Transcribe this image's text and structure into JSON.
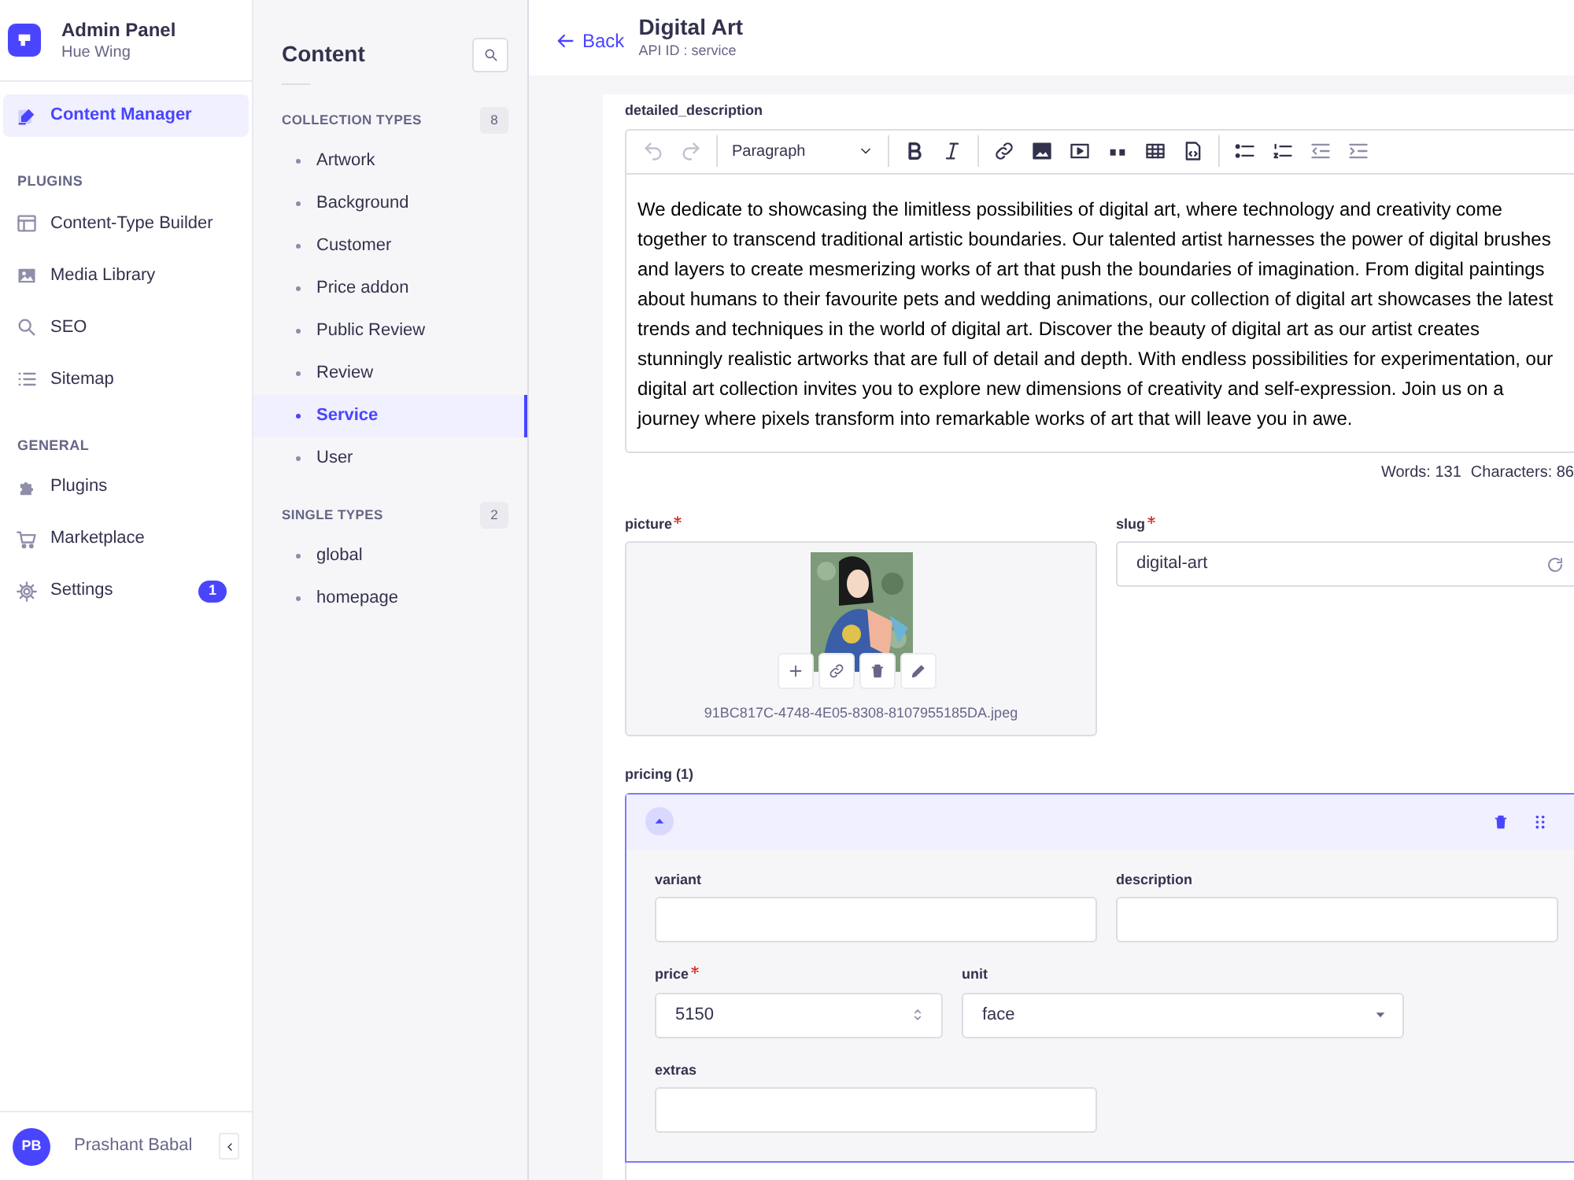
{
  "app": {
    "title": "Admin Panel",
    "subtitle": "Hue Wing"
  },
  "nav": [
    {
      "items": [
        {
          "label": "Content Manager",
          "selected": true
        }
      ]
    },
    {
      "heading": "PLUGINS",
      "items": [
        {
          "label": "Content-Type Builder",
          "selected": false
        },
        {
          "label": "Media Library",
          "selected": false
        },
        {
          "label": "SEO",
          "selected": false
        },
        {
          "label": "Sitemap",
          "selected": false
        }
      ]
    },
    {
      "heading": "GENERAL",
      "items": [
        {
          "label": "Plugins",
          "selected": false
        },
        {
          "label": "Marketplace",
          "selected": false
        },
        {
          "label": "Settings",
          "selected": false,
          "badge": "1"
        }
      ]
    }
  ],
  "user": {
    "initials": "PB",
    "name": "Prashant Babal"
  },
  "content_sidebar": {
    "title": "Content",
    "groups": [
      {
        "heading": "COLLECTION TYPES",
        "count": "8",
        "items": [
          {
            "label": "Artwork",
            "selected": false
          },
          {
            "label": "Background",
            "selected": false
          },
          {
            "label": "Customer",
            "selected": false
          },
          {
            "label": "Price addon",
            "selected": false
          },
          {
            "label": "Public Review",
            "selected": false
          },
          {
            "label": "Review",
            "selected": false
          },
          {
            "label": "Service",
            "selected": true
          },
          {
            "label": "User",
            "selected": false
          }
        ]
      },
      {
        "heading": "SINGLE TYPES",
        "count": "2",
        "items": [
          {
            "label": "global",
            "selected": false
          },
          {
            "label": "homepage",
            "selected": false
          }
        ]
      }
    ]
  },
  "header": {
    "back": "Back",
    "title": "Digital Art",
    "api_id": "API ID : service"
  },
  "editor": {
    "label": "detailed_description",
    "format": "Paragraph",
    "text": "We dedicate to showcasing the limitless possibilities of digital art, where technology and creativity come together to transcend traditional artistic boundaries. Our talented artist harnesses the power of digital brushes and layers to create mesmerizing works of art that push the boundaries of imagination. From digital paintings about humans to their favourite pets and wedding animations, our collection of digital art showcases the latest trends and techniques in the world of digital art. Discover the beauty of digital art as our artist creates stunningly realistic artworks that are full of detail and depth. With endless possibilities for experimentation, our digital art collection invites you to explore new dimensions of creativity and self-expression. Join us on a journey where pixels transform into remarkable works of art that will leave you in awe.",
    "words": "Words: 131",
    "characters": "Characters: 86"
  },
  "picture": {
    "label": "picture",
    "required": true,
    "filename": "91BC817C-4748-4E05-8308-8107955185DA.jpeg"
  },
  "slug": {
    "label": "slug",
    "required": true,
    "value": "digital-art"
  },
  "pricing": {
    "label": "pricing (1)",
    "expanded": true,
    "fields": [
      {
        "kind": "text",
        "label": "variant",
        "required": false
      },
      {
        "kind": "text",
        "label": "description",
        "required": false
      },
      {
        "kind": "number",
        "label": "price",
        "required": true,
        "value": "5150"
      },
      {
        "kind": "select",
        "label": "unit",
        "required": false,
        "value": "face"
      },
      {
        "kind": "text",
        "label": "extras",
        "required": false
      }
    ]
  }
}
